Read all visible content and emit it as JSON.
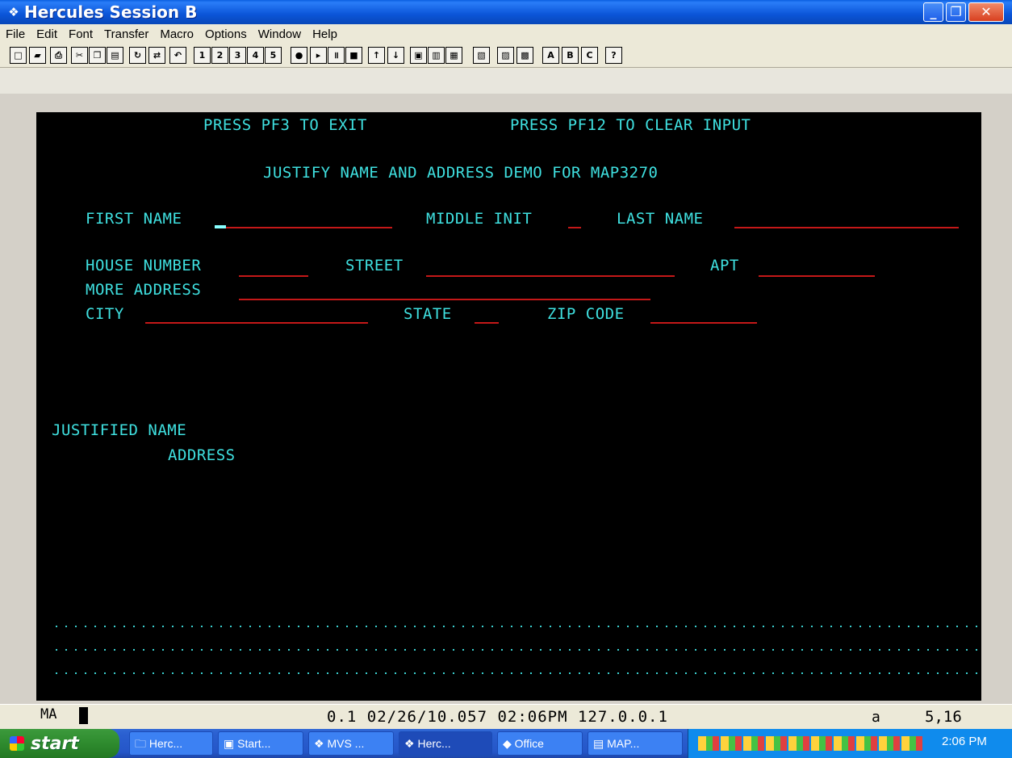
{
  "window": {
    "title": "Hercules Session B",
    "title_icon": "terminal-icon",
    "min_glyph": "_",
    "max_glyph": "❐",
    "close_glyph": "✕"
  },
  "menu": [
    "File",
    "Edit",
    "Font",
    "Transfer",
    "Macro",
    "Options",
    "Window",
    "Help"
  ],
  "toolbar": [
    {
      "name": "new-document-icon",
      "glyph": "□"
    },
    {
      "name": "open-folder-icon",
      "glyph": "▰"
    },
    {
      "name": "print-icon",
      "glyph": "⎙"
    },
    {
      "name": "cut-icon",
      "glyph": "✂"
    },
    {
      "name": "copy-icon",
      "glyph": "❐"
    },
    {
      "name": "paste-icon",
      "glyph": "▤"
    },
    {
      "name": "reconnect-icon",
      "glyph": "↻"
    },
    {
      "name": "disconnect-icon",
      "glyph": "⇄"
    },
    {
      "name": "undo-icon",
      "glyph": "↶"
    },
    {
      "name": "macro-1-icon",
      "glyph": "1"
    },
    {
      "name": "macro-2-icon",
      "glyph": "2"
    },
    {
      "name": "macro-3-icon",
      "glyph": "3"
    },
    {
      "name": "macro-4-icon",
      "glyph": "4"
    },
    {
      "name": "macro-5-icon",
      "glyph": "5"
    },
    {
      "name": "record-icon",
      "glyph": "●"
    },
    {
      "name": "play-icon",
      "glyph": "▸"
    },
    {
      "name": "pause-icon",
      "glyph": "॥"
    },
    {
      "name": "stop-icon",
      "glyph": "■"
    },
    {
      "name": "arrow-up-icon",
      "glyph": "↑"
    },
    {
      "name": "arrow-down-icon",
      "glyph": "↓"
    },
    {
      "name": "properties-icon",
      "glyph": "▣"
    },
    {
      "name": "display-icon",
      "glyph": "▥"
    },
    {
      "name": "keyboard-icon",
      "glyph": "▦"
    },
    {
      "name": "settings-icon",
      "glyph": "▧"
    },
    {
      "name": "notes-icon",
      "glyph": "▨"
    },
    {
      "name": "sessions-icon",
      "glyph": "▩"
    },
    {
      "name": "session-a-icon",
      "glyph": "A"
    },
    {
      "name": "session-b-icon",
      "glyph": "B"
    },
    {
      "name": "session-c-icon",
      "glyph": "C"
    },
    {
      "name": "help-icon",
      "glyph": "?"
    }
  ],
  "screen": {
    "pf3": "PRESS PF3 TO EXIT",
    "pf12": "PRESS PF12 TO CLEAR INPUT",
    "heading": "JUSTIFY NAME AND ADDRESS DEMO FOR MAP3270",
    "first_name_label": "FIRST NAME",
    "middle_init_label": "MIDDLE INIT",
    "last_name_label": "LAST NAME",
    "house_number_label": "HOUSE NUMBER",
    "street_label": "STREET",
    "apt_label": "APT",
    "more_address_label": "MORE ADDRESS",
    "city_label": "CITY",
    "state_label": "STATE",
    "zip_label": "ZIP CODE",
    "justified_name_label": "JUSTIFIED NAME",
    "address_label": "ADDRESS"
  },
  "status": {
    "mode": "MA",
    "info": "0.1 02/26/10.057 02:06PM 127.0.0.1",
    "shift": "a",
    "cursor_pos": "5,16"
  },
  "taskbar": {
    "start_label": "start",
    "tasks": [
      "Herc...",
      "Start...",
      "MVS ...",
      "Herc...",
      "Office",
      "MAP..."
    ],
    "clock": "2:06 PM"
  },
  "colors": {
    "terminal_text": "#3fe0e0",
    "field_underline": "#c41818",
    "screen_bg": "#000000"
  }
}
